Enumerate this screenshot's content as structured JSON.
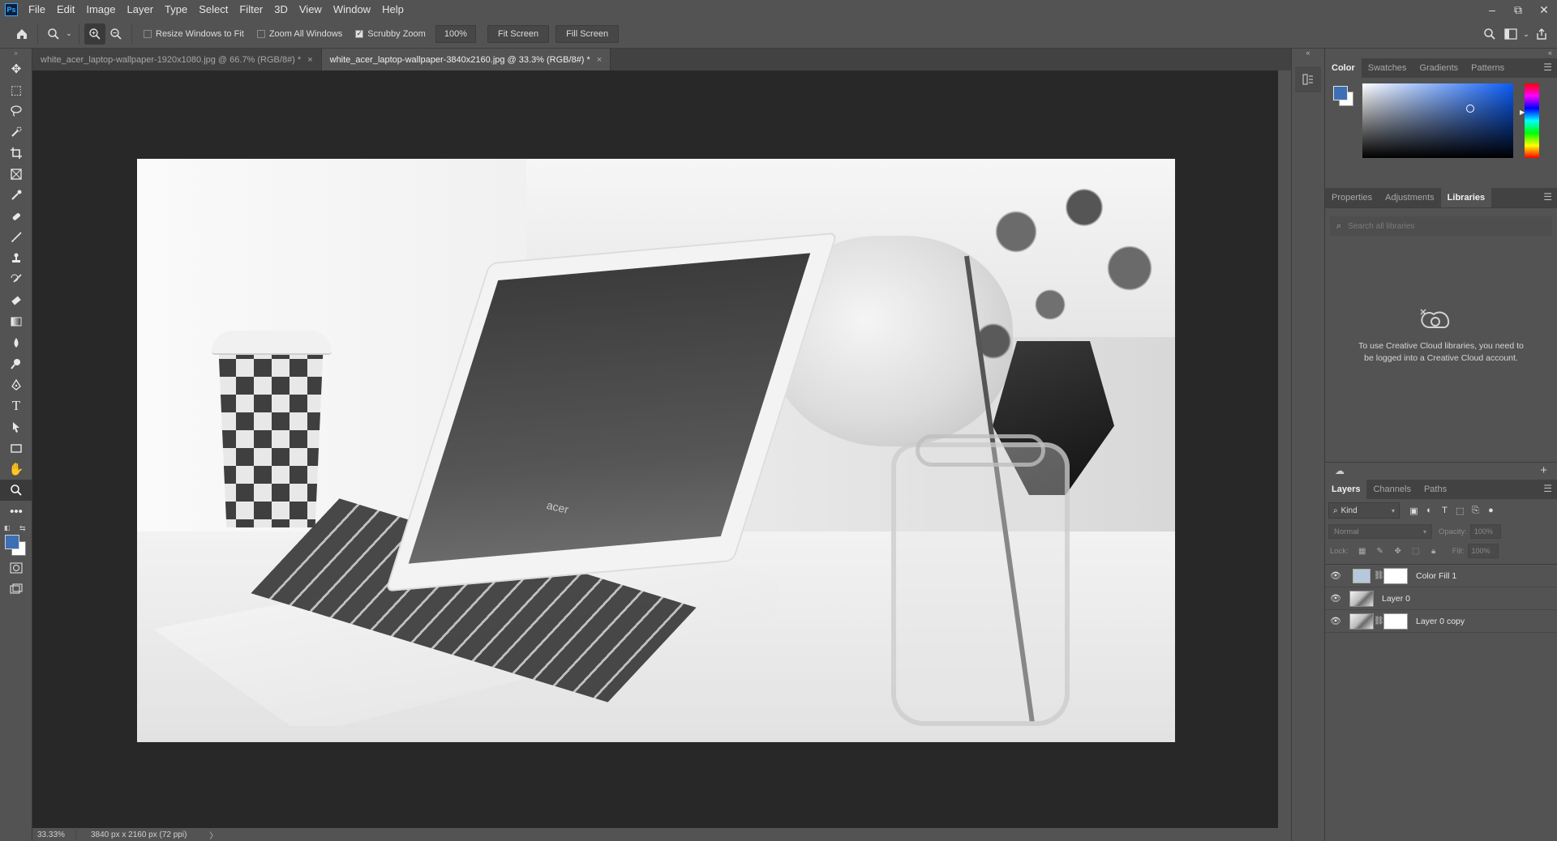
{
  "app": {
    "logo": "Ps"
  },
  "menu": [
    "File",
    "Edit",
    "Image",
    "Layer",
    "Type",
    "Select",
    "Filter",
    "3D",
    "View",
    "Window",
    "Help"
  ],
  "window_controls": {
    "minimize": "–",
    "restore": "⧉",
    "close": "✕"
  },
  "options_bar": {
    "resize_windows_label": "Resize Windows to Fit",
    "resize_windows_checked": false,
    "zoom_all_label": "Zoom All Windows",
    "zoom_all_checked": false,
    "scrubby_zoom_label": "Scrubby Zoom",
    "scrubby_zoom_checked": true,
    "zoom_value": "100%",
    "fit_screen_label": "Fit Screen",
    "fill_screen_label": "Fill Screen"
  },
  "tabs": [
    {
      "label": "white_acer_laptop-wallpaper-1920x1080.jpg @ 66.7% (RGB/8#) *",
      "active": false
    },
    {
      "label": "white_acer_laptop-wallpaper-3840x2160.jpg @ 33.3% (RGB/8#) *",
      "active": true
    }
  ],
  "tabs_close": "×",
  "document": {
    "brand_text": "acer"
  },
  "status": {
    "zoom": "33.33%",
    "info": "3840 px x 2160 px (72 ppi)",
    "arrow": "〉"
  },
  "colors": {
    "foreground": "#3d6fb5",
    "background": "#ffffff",
    "accent": "#31a8ff"
  },
  "panels": {
    "color_tabs": [
      "Color",
      "Swatches",
      "Gradients",
      "Patterns"
    ],
    "color_active": "Color",
    "lib_tabs": [
      "Properties",
      "Adjustments",
      "Libraries"
    ],
    "lib_active": "Libraries",
    "lib_search_placeholder": "Search all libraries",
    "lib_message": "To use Creative Cloud libraries, you need to be logged into a Creative Cloud account.",
    "layers_tabs": [
      "Layers",
      "Channels",
      "Paths"
    ],
    "layers_active": "Layers",
    "kind_label": "Kind",
    "blend_mode": "Normal",
    "opacity_label": "Opacity:",
    "opacity_value": "100%",
    "lock_label": "Lock:",
    "fill_label": "Fill:",
    "fill_value": "100%",
    "layers": [
      {
        "name": "Color Fill 1",
        "type": "fill"
      },
      {
        "name": "Layer 0",
        "type": "photo"
      },
      {
        "name": "Layer 0 copy",
        "type": "photo-mask"
      }
    ]
  }
}
